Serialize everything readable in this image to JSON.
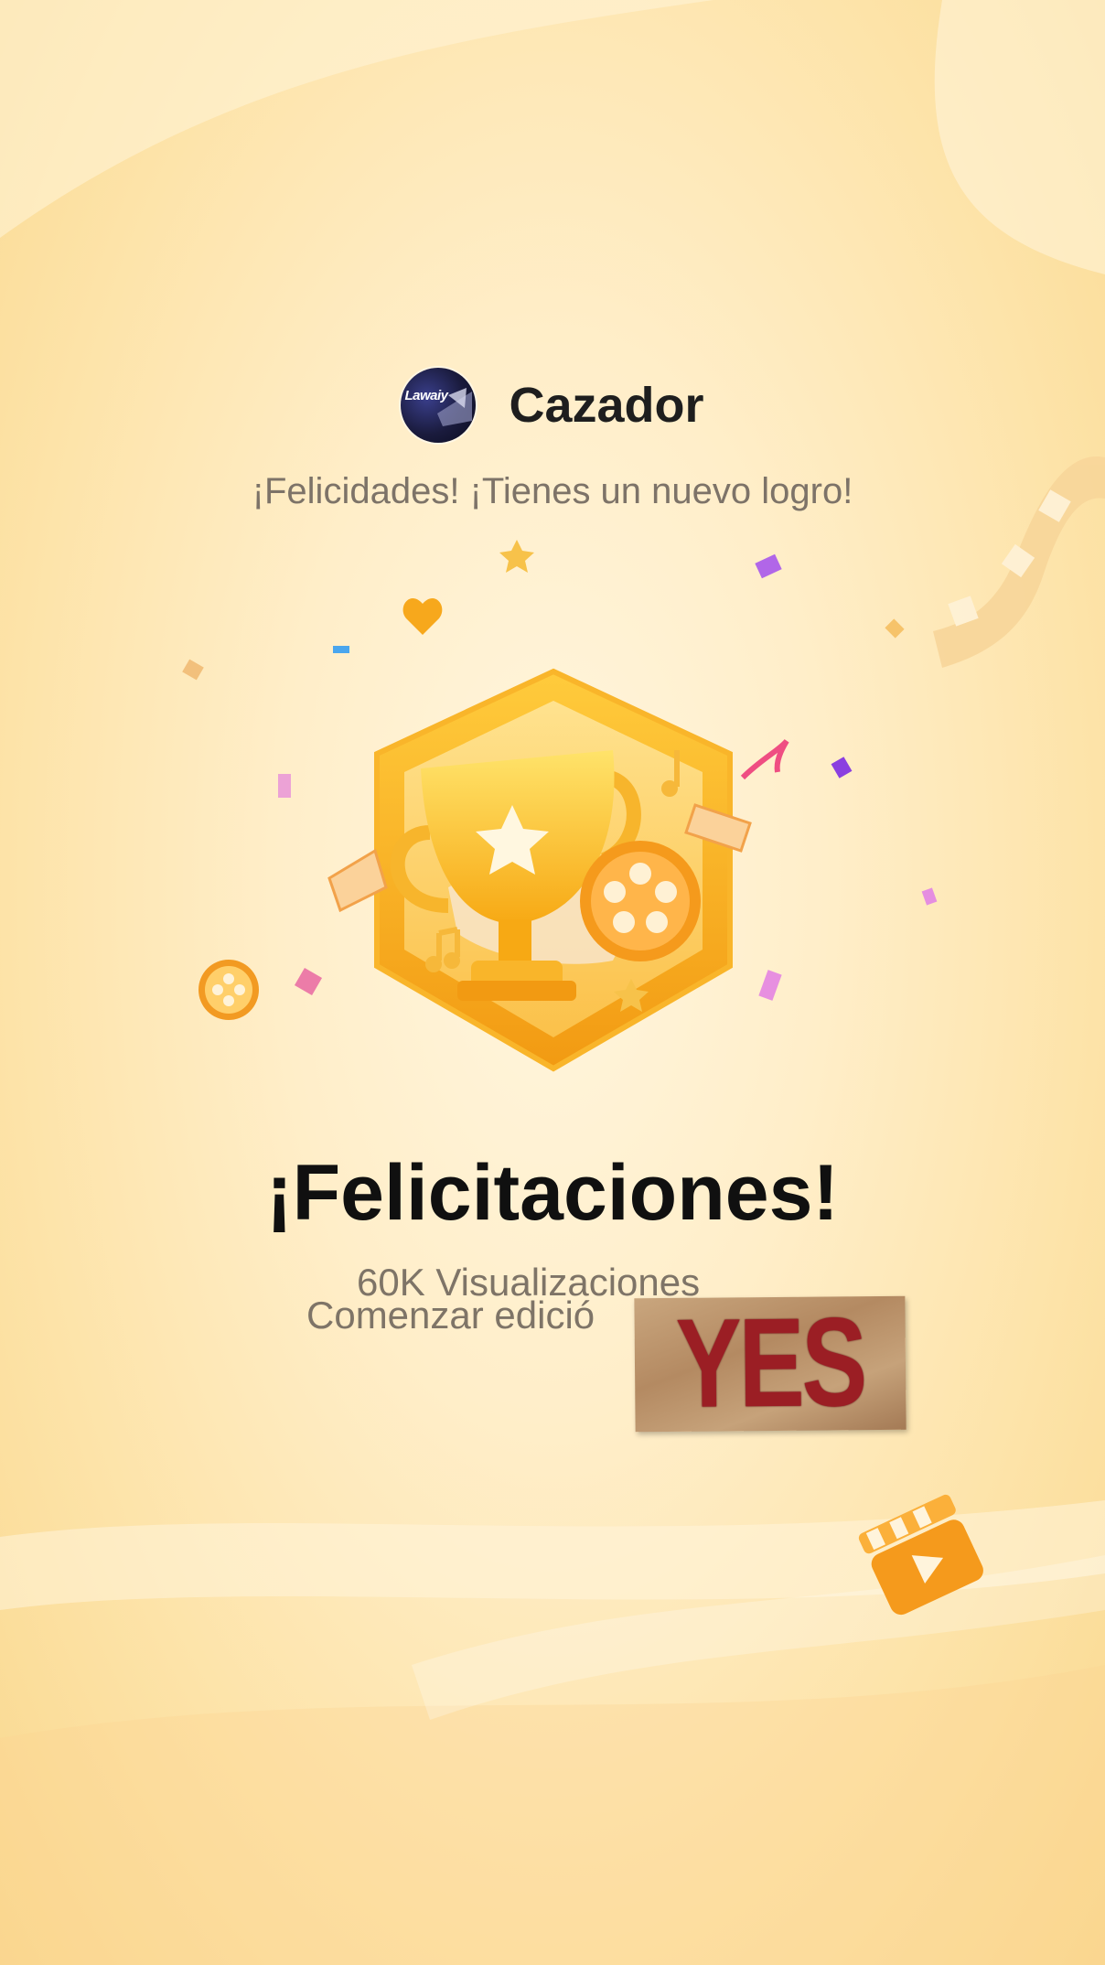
{
  "user": {
    "name": "Cazador",
    "avatar_text": "Lawaiy"
  },
  "subtitle": "¡Felicidades! ¡Tienes un nuevo logro!",
  "achievement": {
    "title": "¡Felicitaciones!",
    "views": "60K Visualizaciones",
    "start_text": "Comenzar edició"
  },
  "sticker": {
    "text": "YES !"
  },
  "colors": {
    "background": "#ffeec9",
    "badge_gold": "#f6b02a",
    "sticker_text": "#9b1e24"
  }
}
